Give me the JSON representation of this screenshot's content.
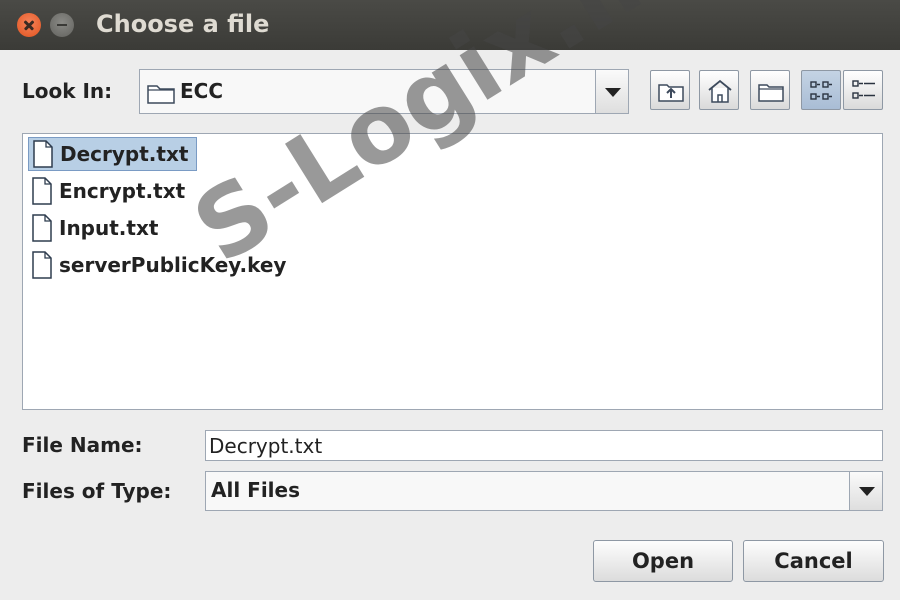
{
  "window": {
    "title": "Choose a file"
  },
  "look_in": {
    "label": "Look In:",
    "value": "ECC"
  },
  "toolbar": {
    "icons": [
      "up-one-level-icon",
      "home-icon",
      "new-folder-icon",
      "list-view-icon",
      "details-view-icon"
    ],
    "selected_view": "list-view"
  },
  "files": [
    {
      "name": "Decrypt.txt",
      "selected": true
    },
    {
      "name": "Encrypt.txt",
      "selected": false
    },
    {
      "name": "Input.txt",
      "selected": false
    },
    {
      "name": "serverPublicKey.key",
      "selected": false
    }
  ],
  "file_name": {
    "label": "File Name:",
    "value": "Decrypt.txt"
  },
  "files_of_type": {
    "label": "Files of Type:",
    "value": "All Files"
  },
  "buttons": {
    "open": "Open",
    "cancel": "Cancel"
  },
  "watermark": "S-Logix.in",
  "colors": {
    "titlebar": "#3c3b37",
    "selection": "#b8cfe5",
    "close_button": "#e95420"
  }
}
